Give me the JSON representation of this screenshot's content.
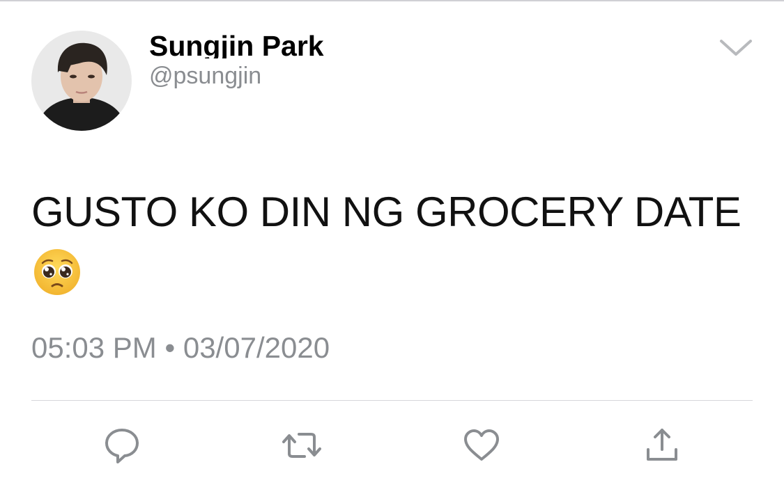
{
  "tweet": {
    "display_name": "Sungjin Park",
    "handle": "@psungjin",
    "text": "GUSTO KO DIN NG GROCERY DATE",
    "emoji": "pleading-face",
    "time": "05:03 PM",
    "separator": "•",
    "date": "03/07/2020"
  },
  "actions": {
    "reply": "reply-icon",
    "retweet": "retweet-icon",
    "like": "heart-icon",
    "share": "share-icon"
  },
  "colors": {
    "icon_gray": "#8a8d91",
    "emoji_yellow": "#f7c23a"
  }
}
